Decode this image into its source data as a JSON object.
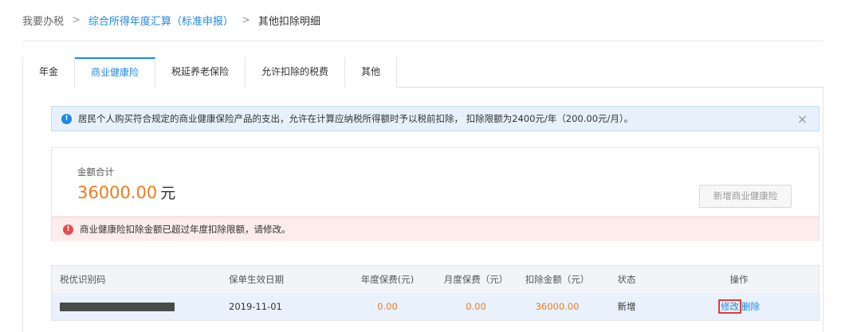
{
  "breadcrumb": {
    "root": "我要办税",
    "level2": "综合所得年度汇算（标准申报）",
    "current": "其他扣除明细",
    "separator": ">"
  },
  "tabs": [
    {
      "label": "年金",
      "active": false
    },
    {
      "label": "商业健康险",
      "active": true
    },
    {
      "label": "税延养老保险",
      "active": false
    },
    {
      "label": "允许扣除的税费",
      "active": false
    },
    {
      "label": "其他",
      "active": false
    }
  ],
  "info_banner": {
    "icon": "info-icon",
    "text": "居民个人购买符合规定的商业健康保险产品的支出，允许在计算应纳税所得额时予以税前扣除， 扣除限额为2400元/年（200.00元/月）。",
    "close": "×"
  },
  "summary": {
    "total_label": "金额合计",
    "total_value": "36000.00",
    "total_unit": "元",
    "add_button": "新增商业健康险",
    "error_text": "商业健康险扣除金额已超过年度扣除限额，请修改。"
  },
  "table": {
    "headers": [
      "税优识别码",
      "保单生效日期",
      "年度保费(元)",
      "月度保费（元）",
      "扣除金额（元）",
      "状态",
      "操作"
    ],
    "rows": [
      {
        "code": "",
        "effective_date": "2019-11-01",
        "annual_premium": "0.00",
        "monthly_premium": "0.00",
        "deduction": "36000.00",
        "status": "新增",
        "edit": "修改",
        "delete": "删除"
      }
    ]
  },
  "colors": {
    "accent": "#1e88e5",
    "amount": "#f07b1f",
    "error": "#e94b4b"
  }
}
